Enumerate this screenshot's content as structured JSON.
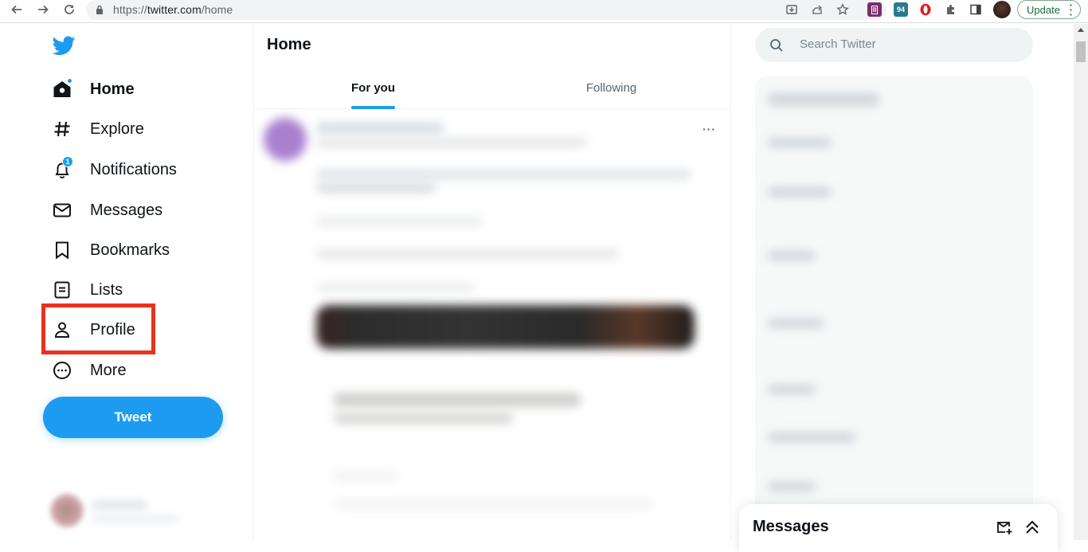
{
  "browser": {
    "url_scheme": "https://",
    "url_host": "twitter.com",
    "url_path": "/home",
    "update_label": "Update",
    "extensions": [
      {
        "name": "ext-purple",
        "color": "#7b2d6e",
        "glyph": "II"
      },
      {
        "name": "ext-teal",
        "color": "#2a7a8c",
        "glyph": "94"
      },
      {
        "name": "opera",
        "color": "#e51a1a",
        "glyph": "O"
      }
    ]
  },
  "sidebar": {
    "items": [
      {
        "id": "home",
        "label": "Home",
        "icon": "home-icon",
        "active": true,
        "badge": "dot"
      },
      {
        "id": "explore",
        "label": "Explore",
        "icon": "hashtag-icon"
      },
      {
        "id": "notifications",
        "label": "Notifications",
        "icon": "bell-icon",
        "badge_count": "1"
      },
      {
        "id": "messages",
        "label": "Messages",
        "icon": "envelope-icon"
      },
      {
        "id": "bookmarks",
        "label": "Bookmarks",
        "icon": "bookmark-icon"
      },
      {
        "id": "lists",
        "label": "Lists",
        "icon": "list-icon"
      },
      {
        "id": "profile",
        "label": "Profile",
        "icon": "person-icon",
        "highlighted": true
      },
      {
        "id": "more",
        "label": "More",
        "icon": "more-circle-icon"
      }
    ],
    "tweet_button": "Tweet"
  },
  "main": {
    "title": "Home",
    "tabs": [
      {
        "label": "For you",
        "active": true
      },
      {
        "label": "Following",
        "active": false
      }
    ],
    "tweet_more": "···"
  },
  "right": {
    "search_placeholder": "Search Twitter",
    "messages_drawer_title": "Messages"
  },
  "colors": {
    "accent": "#1d9bf0",
    "highlight": "#e8331e"
  }
}
